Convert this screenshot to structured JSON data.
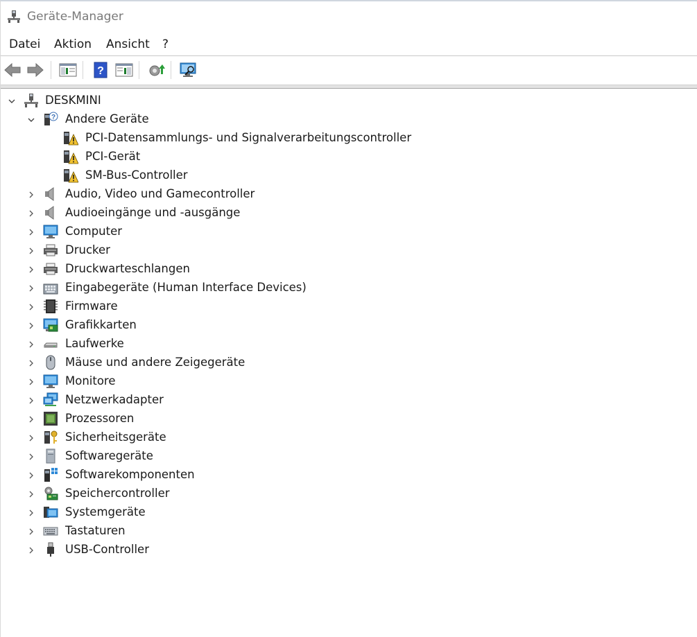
{
  "window": {
    "title": "Geräte-Manager"
  },
  "menu": {
    "items": [
      "Datei",
      "Aktion",
      "Ansicht",
      "?"
    ]
  },
  "toolbar": {
    "buttons": [
      "back-arrow-icon",
      "forward-arrow-icon",
      "show-hide-console-tree-icon",
      "help-icon",
      "action-pane-icon",
      "update-driver-icon",
      "scan-hardware-icon"
    ]
  },
  "tree": {
    "root": "DESKMINI",
    "other_devices": {
      "label": "Andere Geräte",
      "children": [
        "PCI-Datensammlungs- und Signalverarbeitungscontroller",
        "PCI-Gerät",
        "SM-Bus-Controller"
      ]
    },
    "categories": [
      "Audio, Video und Gamecontroller",
      "Audioeingänge und -ausgänge",
      "Computer",
      "Drucker",
      "Druckwarteschlangen",
      "Eingabegeräte (Human Interface Devices)",
      "Firmware",
      "Grafikkarten",
      "Laufwerke",
      "Mäuse und andere Zeigegeräte",
      "Monitore",
      "Netzwerkadapter",
      "Prozessoren",
      "Sicherheitsgeräte",
      "Softwaregeräte",
      "Softwarekomponenten",
      "Speichercontroller",
      "Systemgeräte",
      "Tastaturen",
      "USB-Controller"
    ]
  }
}
